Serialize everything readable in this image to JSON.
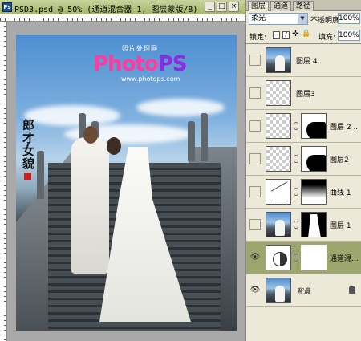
{
  "window": {
    "title": "PSD3.psd @ 50% (通道混合器 1, 图层蒙版/8)",
    "ps_icon": "Ps",
    "buttons": {
      "minimize": "_",
      "maximize": "□",
      "close": "×"
    }
  },
  "canvas": {
    "logo_top": "照片处理网",
    "logo_part1": "Photo",
    "logo_part2": "PS",
    "logo_url": "www.photops.com"
  },
  "panel": {
    "tabs": [
      "图层",
      "通道",
      "路径"
    ],
    "blend_mode": "柔光",
    "opacity_label": "不透明度:",
    "opacity_value": "100%",
    "lock_label": "锁定:",
    "fill_label": "填充:",
    "fill_value": "100%",
    "layers": [
      {
        "name": "图层 4",
        "thumb": "photo",
        "mask": null,
        "visible": false,
        "selected": false
      },
      {
        "name": "图层3",
        "thumb": "transparent",
        "mask": null,
        "visible": false,
        "selected": false
      },
      {
        "name": "图层 2 ...",
        "thumb": "transparent",
        "mask": "mask-a",
        "visible": false,
        "selected": false
      },
      {
        "name": "图层2",
        "thumb": "transparent",
        "mask": "mask-a",
        "visible": false,
        "selected": false
      },
      {
        "name": "曲线 1",
        "thumb": "curves-adjustment",
        "mask": "mask-gradient",
        "visible": false,
        "selected": false
      },
      {
        "name": "图层 1",
        "thumb": "photo",
        "mask": "mask-silhouette",
        "visible": false,
        "selected": false
      },
      {
        "name": "通道混...",
        "thumb": "channel-mixer-adjustment",
        "mask": "mask-white",
        "visible": true,
        "selected": true
      },
      {
        "name": "背景",
        "thumb": "photo",
        "mask": null,
        "visible": true,
        "selected": false,
        "locked": true
      }
    ]
  },
  "colors": {
    "titlebar": "#a7b66b",
    "selected_layer": "#9da66f",
    "sky": "#4d8ed1",
    "logo_pink": "#ff3c9e",
    "logo_purple": "#8b2be2"
  }
}
